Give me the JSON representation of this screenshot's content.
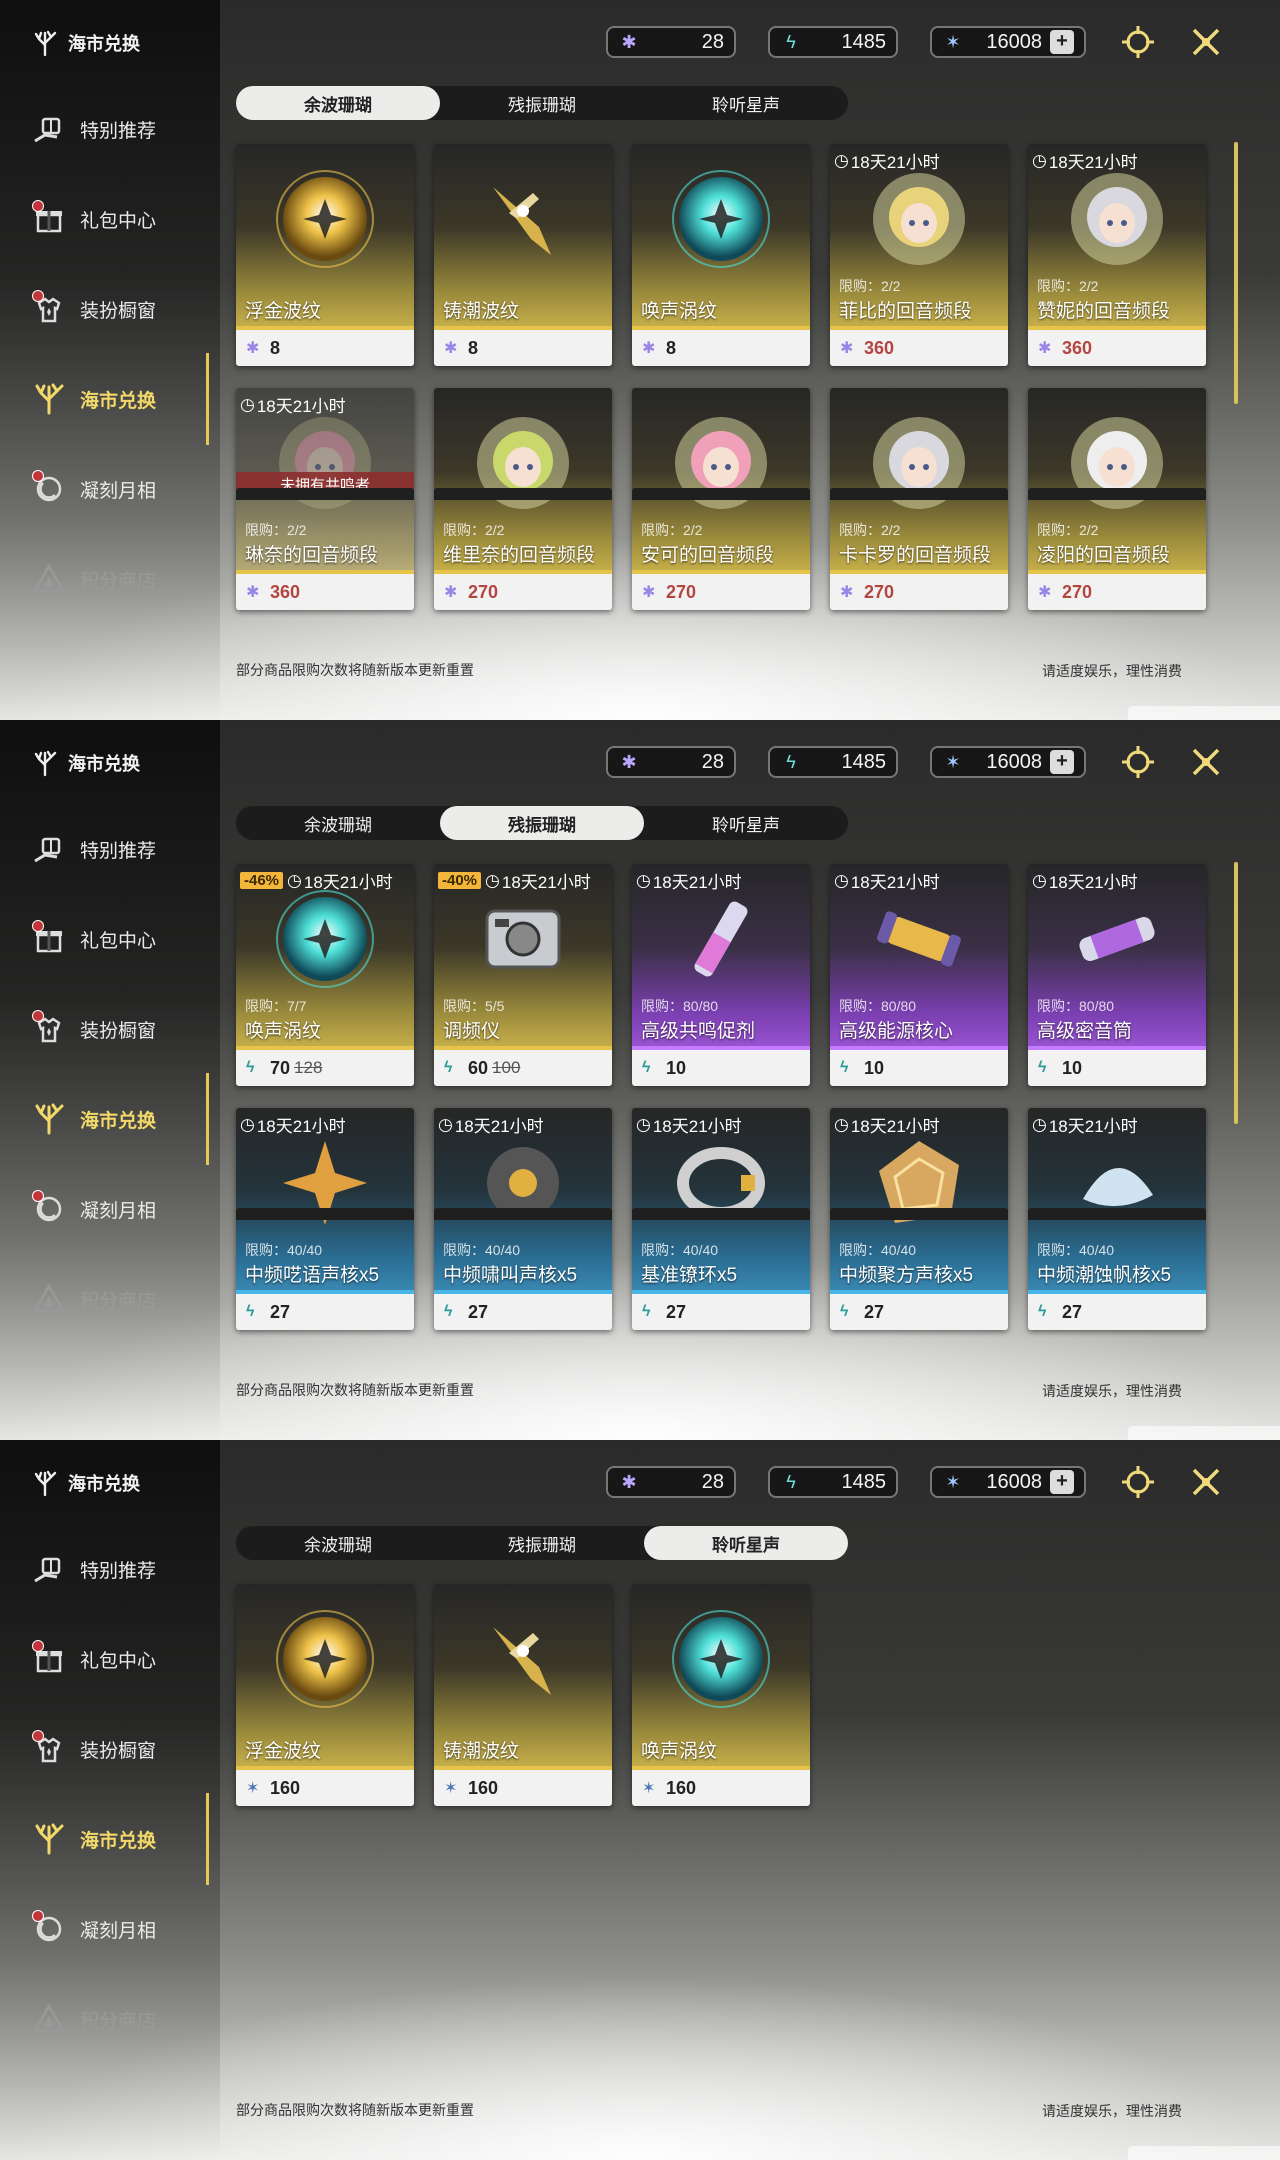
{
  "colors": {
    "accent_gold": "#e6c857",
    "rarity_gold": "#e6c44a",
    "rarity_purple": "#c47bff",
    "rarity_blue": "#49b6ea",
    "red_price": "#b34640"
  },
  "header": {
    "title": "海市兑换",
    "currencies": [
      {
        "icon": "afterglow-coral-icon",
        "value": "28"
      },
      {
        "icon": "oscillated-coral-icon",
        "value": "1485"
      },
      {
        "icon": "star-voice-icon",
        "value": "16008",
        "plus": "+"
      }
    ]
  },
  "sidebar": [
    {
      "label": "特别推荐",
      "icon": "gift-hand-icon",
      "dot": false,
      "state": "normal"
    },
    {
      "label": "礼包中心",
      "icon": "gift-box-icon",
      "dot": true,
      "state": "normal"
    },
    {
      "label": "装扮橱窗",
      "icon": "outfit-icon",
      "dot": true,
      "state": "normal"
    },
    {
      "label": "海市兑换",
      "icon": "coral-icon",
      "dot": false,
      "state": "active"
    },
    {
      "label": "凝刻月相",
      "icon": "moon-icon",
      "dot": true,
      "state": "normal"
    },
    {
      "label": "积分商店",
      "icon": "triangle-icon",
      "dot": false,
      "state": "dim"
    }
  ],
  "tabs": [
    "余波珊瑚",
    "残振珊瑚",
    "聆听星声"
  ],
  "notes": {
    "left": "部分商品限购次数将随新版本更新重置",
    "right": "请适度娱乐，理性消费"
  },
  "screens": [
    {
      "active_tab": 0,
      "cards": [
        {
          "name": "浮金波纹",
          "price": "8",
          "rarity": "gold",
          "art": "gold-orb",
          "currency": "purple"
        },
        {
          "name": "铸潮波纹",
          "price": "8",
          "rarity": "gold",
          "art": "dagger",
          "currency": "purple"
        },
        {
          "name": "唤声涡纹",
          "price": "8",
          "rarity": "gold",
          "art": "teal-orb",
          "currency": "purple"
        },
        {
          "name": "菲比的回音频段",
          "price": "360",
          "rarity": "gold",
          "art": "portrait-blonde",
          "timer": "18天21小时",
          "limit": "限购：2/2",
          "red": true,
          "currency": "purple"
        },
        {
          "name": "赞妮的回音频段",
          "price": "360",
          "rarity": "gold",
          "art": "portrait-silver",
          "timer": "18天21小时",
          "limit": "限购：2/2",
          "red": true,
          "currency": "purple"
        },
        {
          "name": "琳奈的回音频段",
          "price": "360",
          "rarity": "gold",
          "art": "portrait-pink",
          "timer": "18天21小时",
          "limit": "限购：2/2",
          "red": true,
          "lock": "未拥有共鸣者",
          "faded": true,
          "currency": "purple"
        },
        {
          "name": "维里奈的回音频段",
          "price": "270",
          "rarity": "gold",
          "art": "portrait-green",
          "limit": "限购：2/2",
          "red": true,
          "currency": "purple"
        },
        {
          "name": "安可的回音频段",
          "price": "270",
          "rarity": "gold",
          "art": "portrait-pink",
          "limit": "限购：2/2",
          "red": true,
          "currency": "purple"
        },
        {
          "name": "卡卡罗的回音频段",
          "price": "270",
          "rarity": "gold",
          "art": "portrait-silver",
          "limit": "限购：2/2",
          "red": true,
          "currency": "purple"
        },
        {
          "name": "凌阳的回音频段",
          "price": "270",
          "rarity": "gold",
          "art": "portrait-white",
          "limit": "限购：2/2",
          "red": true,
          "currency": "purple"
        }
      ]
    },
    {
      "active_tab": 1,
      "cards": [
        {
          "name": "唤声涡纹",
          "price": "70",
          "old_price": "128",
          "discount": "-46%",
          "rarity": "gold",
          "art": "teal-orb",
          "timer": "18天21小时",
          "limit": "限购：7/7",
          "currency": "teal"
        },
        {
          "name": "调频仪",
          "price": "60",
          "old_price": "100",
          "discount": "-40%",
          "rarity": "gold",
          "art": "device",
          "timer": "18天21小时",
          "limit": "限购：5/5",
          "currency": "teal"
        },
        {
          "name": "高级共鸣促剂",
          "price": "10",
          "rarity": "purple",
          "art": "vial",
          "timer": "18天21小时",
          "limit": "限购：80/80",
          "currency": "teal"
        },
        {
          "name": "高级能源核心",
          "price": "10",
          "rarity": "purple",
          "art": "capsule",
          "timer": "18天21小时",
          "limit": "限购：80/80",
          "currency": "teal"
        },
        {
          "name": "高级密音筒",
          "price": "10",
          "rarity": "purple",
          "art": "tube",
          "timer": "18天21小时",
          "limit": "限购：80/80",
          "currency": "teal"
        },
        {
          "name": "中频呓语声核x5",
          "price": "27",
          "rarity": "blue",
          "art": "star-shard",
          "timer": "18天21小时",
          "limit": "限购：40/40",
          "currency": "teal"
        },
        {
          "name": "中频啸叫声核x5",
          "price": "27",
          "rarity": "blue",
          "art": "dark-core",
          "timer": "18天21小时",
          "limit": "限购：40/40",
          "currency": "teal"
        },
        {
          "name": "基准镣环x5",
          "price": "27",
          "rarity": "blue",
          "art": "ring",
          "timer": "18天21小时",
          "limit": "限购：40/40",
          "currency": "teal"
        },
        {
          "name": "中频聚方声核x5",
          "price": "27",
          "rarity": "blue",
          "art": "gold-shell",
          "timer": "18天21小时",
          "limit": "限购：40/40",
          "currency": "teal"
        },
        {
          "name": "中频潮蚀帆核x5",
          "price": "27",
          "rarity": "blue",
          "art": "shell",
          "timer": "18天21小时",
          "limit": "限购：40/40",
          "currency": "teal"
        }
      ]
    },
    {
      "active_tab": 2,
      "cards": [
        {
          "name": "浮金波纹",
          "price": "160",
          "rarity": "gold",
          "art": "gold-orb",
          "currency": "blue"
        },
        {
          "name": "铸潮波纹",
          "price": "160",
          "rarity": "gold",
          "art": "dagger",
          "currency": "blue"
        },
        {
          "name": "唤声涡纹",
          "price": "160",
          "rarity": "gold",
          "art": "teal-orb",
          "currency": "blue"
        }
      ]
    }
  ]
}
